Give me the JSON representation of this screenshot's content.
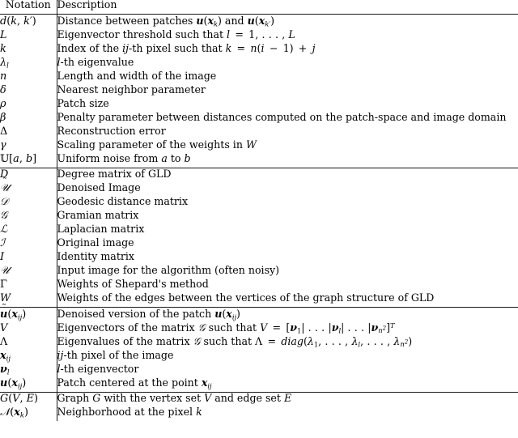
{
  "document": {
    "type": "notation-table",
    "header": {
      "notation_label": "Notation",
      "description_label": "Description"
    },
    "sections": [
      {
        "id": "scalars-parameters",
        "rows": [
          {
            "notation": "d(k, k′)",
            "description": "Distance between patches u(x_k) and u(x_k′)"
          },
          {
            "notation": "L",
            "description": "Eigenvector threshold such that l = 1, . . . , L"
          },
          {
            "notation": "k",
            "description": "Index of the ij-th pixel such that k = n(i − 1) + j"
          },
          {
            "notation": "λ_l",
            "description": "l-th eigenvalue"
          },
          {
            "notation": "n",
            "description": "Length and width of the image"
          },
          {
            "notation": "δ",
            "description": "Nearest neighbor parameter"
          },
          {
            "notation": "ρ",
            "description": "Patch size"
          },
          {
            "notation": "β",
            "description": "Penalty parameter between distances computed on the patch-space and image domain"
          },
          {
            "notation": "Δ",
            "description": "Reconstruction error"
          },
          {
            "notation": "γ",
            "description": "Scaling parameter of the weights in W"
          },
          {
            "notation": "U[a, b]",
            "description": "Uniform noise from a to b"
          }
        ]
      },
      {
        "id": "matrices-images",
        "rows": [
          {
            "notation": "D",
            "description": "Degree matrix of GLD"
          },
          {
            "notation": "Ũ",
            "description": "Denoised Image"
          },
          {
            "notation": "D (cal)",
            "description": "Geodesic distance matrix"
          },
          {
            "notation": "G (cal)",
            "description": "Gramian matrix"
          },
          {
            "notation": "L (cal)",
            "description": "Laplacian matrix"
          },
          {
            "notation": "I (cal)",
            "description": "Original image"
          },
          {
            "notation": "I",
            "description": "Identity matrix"
          },
          {
            "notation": "U (cal)",
            "description": "Input image for the algorithm (often noisy)"
          },
          {
            "notation": "Γ",
            "description": "Weights of Shepard's method"
          },
          {
            "notation": "W",
            "description": "Weights of the edges between the vertices of the graph structure of GLD"
          }
        ]
      },
      {
        "id": "vectors-patches",
        "rows": [
          {
            "notation": "ũ(x_ij)",
            "description": "Denoised version of the patch u(x_ij)"
          },
          {
            "notation": "V",
            "description": "Eigenvectors of the matrix G such that V = [ν_1| . . . |ν_l| . . . |ν_n²]^T"
          },
          {
            "notation": "Λ",
            "description": "Eigenvalues of the matrix G such that Λ = diag(λ_1, . . . , λ_l, . . . , λ_n²)"
          },
          {
            "notation": "x_ij",
            "description": "ij-th pixel of the image"
          },
          {
            "notation": "ν_l",
            "description": "l-th eigenvector"
          },
          {
            "notation": "u(x_ij)",
            "description": "Patch centered at the point x_ij"
          }
        ]
      },
      {
        "id": "graph-objects",
        "rows": [
          {
            "notation": "G(V, E)",
            "description": "Graph G with the vertex set V and edge set E"
          },
          {
            "notation": "N(x_k)",
            "description": "Neighborhood at the pixel k"
          }
        ]
      }
    ]
  },
  "style": {
    "rule_color": "#1a1a1a",
    "text_color": "#000000",
    "background": "#ffffff"
  }
}
